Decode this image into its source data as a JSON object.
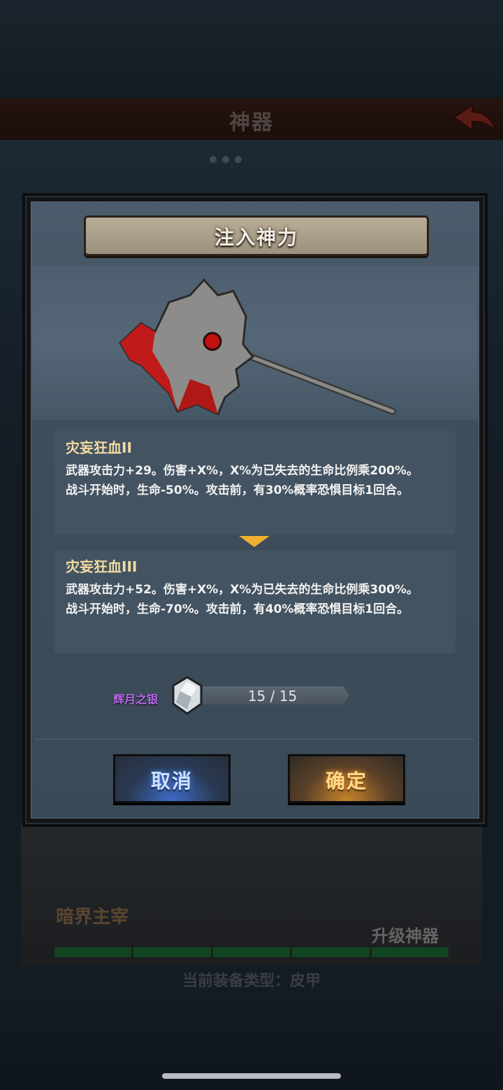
{
  "screen": {
    "title": "神器",
    "dark_realm_label": "暗界主宰",
    "upgrade_label": "升级神器",
    "equip_type": "当前装备类型：皮甲"
  },
  "dialog": {
    "title": "注入神力",
    "current_skill": {
      "name": "灾妄狂血II",
      "line1": "武器攻击力+29。伤害+X%，X%为已失去的生命比例乘200%。",
      "line2": "战斗开始时，生命-50%。攻击前，有30%概率恐惧目标1回合。"
    },
    "next_skill": {
      "name": "灾妄狂血III",
      "line1": "武器攻击力+52。伤害+X%，X%为已失去的生命比例乘300%。",
      "line2": "战斗开始时，生命-70%。攻击前，有40%概率恐惧目标1回合。"
    },
    "material": {
      "name": "辉月之银",
      "count_text": "15 / 15",
      "icon": "crystal-icon"
    },
    "cancel_label": "取消",
    "confirm_label": "确定"
  },
  "colors": {
    "skill_name": "#f3dba2",
    "material_name": "#b86ae8",
    "arrow": "#f0b030"
  }
}
